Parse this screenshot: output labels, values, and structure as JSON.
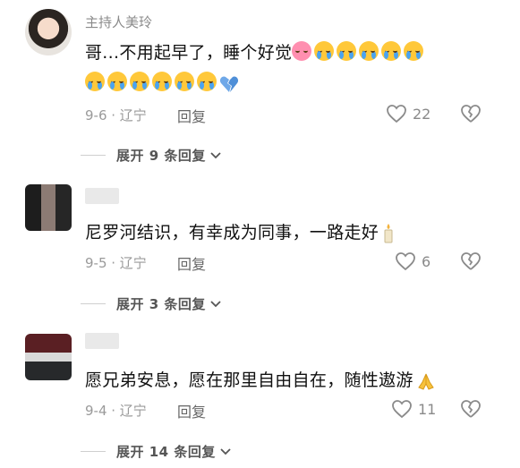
{
  "comments": [
    {
      "author": "主持人美玲",
      "text_line1": "哥...不用起早了，睡个好觉",
      "meta": "9-6 · 辽宁",
      "reply_label": "回复",
      "likes": "22",
      "expand_label": "展开 9 条回复"
    },
    {
      "author": "",
      "text_line1": "尼罗河结识，有幸成为同事，一路走好",
      "meta": "9-5 · 辽宁",
      "reply_label": "回复",
      "likes": "6",
      "expand_label": "展开 3 条回复"
    },
    {
      "author": "",
      "text_line1": "愿兄弟安息，愿在那里自由自在，随性遨游",
      "meta": "9-4 · 辽宁",
      "reply_label": "回复",
      "likes": "11",
      "expand_label": "展开 14 条回复"
    }
  ],
  "icons": {
    "like": "heart-outline-icon",
    "dislike": "broken-heart-icon",
    "expand": "chevron-down-icon",
    "emoji_cry": "loudly-crying-face-icon",
    "emoji_sleep": "sleeping-face-icon",
    "emoji_broken_heart": "broken-heart-emoji",
    "emoji_candle": "candle-icon",
    "emoji_pray": "folded-hands-icon"
  },
  "colors": {
    "meta": "#9a9a9a",
    "name": "#8a8a8a",
    "text": "#111111"
  }
}
